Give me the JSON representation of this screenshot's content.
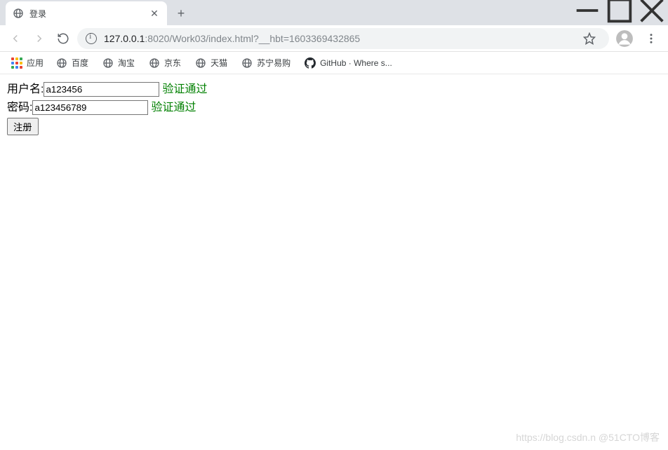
{
  "window": {
    "minimize": "—",
    "maximize": "☐",
    "close": "✕"
  },
  "tab": {
    "title": "登录",
    "close": "✕",
    "new_tab": "+"
  },
  "omnibox": {
    "host": "127.0.0.1",
    "port_path": ":8020/Work03/index.html?__hbt=1603369432865"
  },
  "bookmarks": {
    "apps_label": "应用",
    "items": [
      {
        "label": "百度",
        "icon": "globe"
      },
      {
        "label": "淘宝",
        "icon": "globe"
      },
      {
        "label": "京东",
        "icon": "globe"
      },
      {
        "label": "天猫",
        "icon": "globe"
      },
      {
        "label": "苏宁易购",
        "icon": "globe"
      },
      {
        "label": "GitHub · Where s...",
        "icon": "github"
      }
    ]
  },
  "form": {
    "username_label": "用户名:",
    "username_value": "a123456",
    "username_msg": "验证通过",
    "password_label": "密码:",
    "password_value": "a123456789",
    "password_msg": "验证通过",
    "submit_label": "注册"
  },
  "watermark": "https://blog.csdn.n @51CTO博客",
  "apps_colors": [
    "#ea4335",
    "#fbbc05",
    "#34a853",
    "#4285f4",
    "#ea4335",
    "#fbbc05",
    "#34a853",
    "#4285f4",
    "#ea4335"
  ]
}
